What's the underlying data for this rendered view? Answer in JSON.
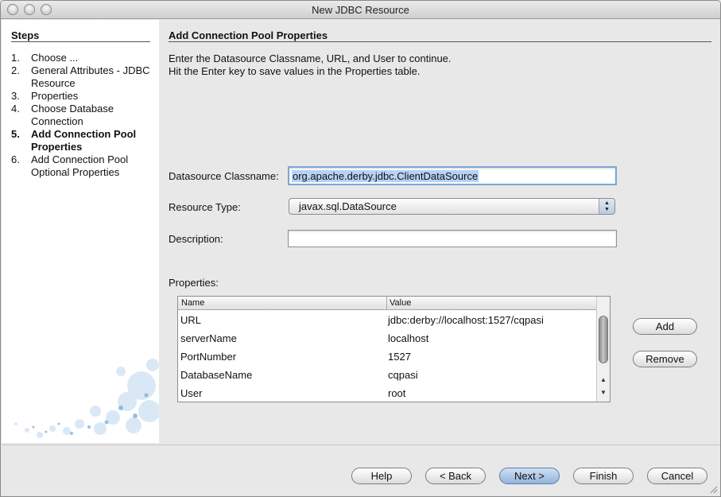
{
  "window": {
    "title": "New JDBC Resource"
  },
  "steps": {
    "title": "Steps",
    "items": [
      {
        "num": "1.",
        "label": "Choose ..."
      },
      {
        "num": "2.",
        "label": "General Attributes - JDBC Resource"
      },
      {
        "num": "3.",
        "label": "Properties"
      },
      {
        "num": "4.",
        "label": "Choose Database Connection"
      },
      {
        "num": "5.",
        "label": "Add Connection Pool Properties"
      },
      {
        "num": "6.",
        "label": "Add Connection Pool Optional Properties"
      }
    ]
  },
  "main": {
    "title": "Add Connection Pool Properties",
    "instruction_1": "Enter the Datasource Classname, URL, and User to continue.",
    "instruction_2": "Hit the Enter key to save values in the Properties table.",
    "classname": {
      "label": "Datasource Classname:",
      "value": "org.apache.derby.jdbc.ClientDataSource"
    },
    "resource_type": {
      "label": "Resource Type:",
      "value": "javax.sql.DataSource"
    },
    "description": {
      "label": "Description:",
      "value": ""
    },
    "properties": {
      "label": "Properties:",
      "columns": {
        "name": "Name",
        "value": "Value"
      },
      "rows": [
        {
          "name": "URL",
          "value": "jdbc:derby://localhost:1527/cqpasi"
        },
        {
          "name": "serverName",
          "value": "localhost"
        },
        {
          "name": "PortNumber",
          "value": "1527"
        },
        {
          "name": "DatabaseName",
          "value": "cqpasi"
        },
        {
          "name": "User",
          "value": "root"
        }
      ],
      "add_label": "Add",
      "remove_label": "Remove"
    }
  },
  "footer": {
    "help": "Help",
    "back": "< Back",
    "next": "Next >",
    "finish": "Finish",
    "cancel": "Cancel"
  }
}
